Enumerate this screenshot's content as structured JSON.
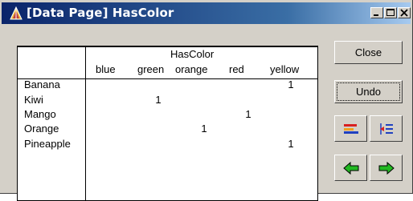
{
  "window": {
    "title": "[Data Page] HasColor"
  },
  "table": {
    "column_group_label": "HasColor",
    "columns": [
      "blue",
      "green",
      "orange",
      "red",
      "yellow"
    ],
    "rows": [
      {
        "label": "Banana",
        "cells": [
          "",
          "",
          "",
          "",
          "1"
        ]
      },
      {
        "label": "Kiwi",
        "cells": [
          "",
          "1",
          "",
          "",
          ""
        ]
      },
      {
        "label": "Mango",
        "cells": [
          "",
          "",
          "",
          "1",
          ""
        ]
      },
      {
        "label": "Orange",
        "cells": [
          "",
          "",
          "1",
          "",
          ""
        ]
      },
      {
        "label": "Pineapple",
        "cells": [
          "",
          "",
          "",
          "",
          "1"
        ]
      }
    ]
  },
  "buttons": {
    "close_label": "Close",
    "undo_label": "Undo"
  },
  "icons": {
    "edit": "edit-icon",
    "sort": "sort-icon",
    "back": "arrow-left-icon",
    "forward": "arrow-right-icon"
  },
  "colors": {
    "titlebar_start": "#0a246a",
    "arrow_green": "#22b822",
    "arrow_outline": "#000000"
  }
}
